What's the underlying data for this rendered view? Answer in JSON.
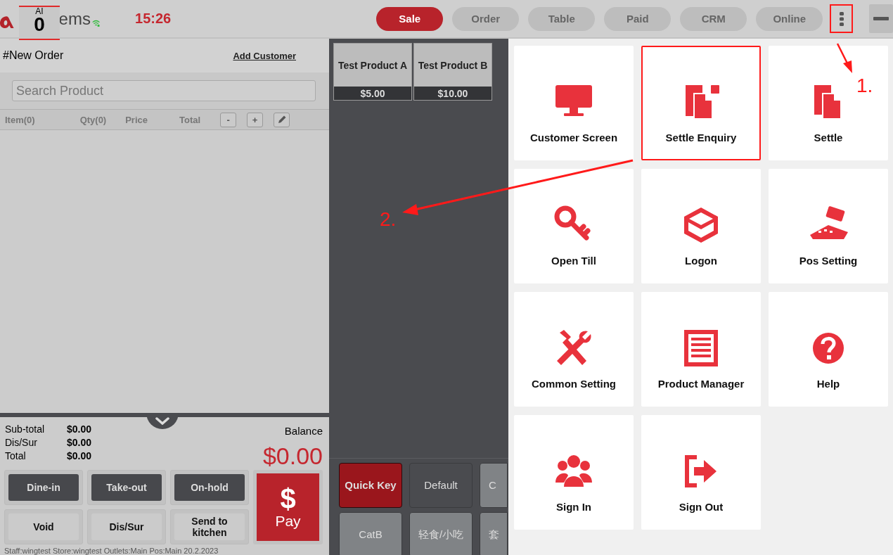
{
  "header": {
    "badge": {
      "label": "AI",
      "count": "0"
    },
    "brand_text": "ems",
    "time": "15:26",
    "tabs": [
      {
        "label": "Sale",
        "selected": true
      },
      {
        "label": "Order",
        "selected": false
      },
      {
        "label": "Table",
        "selected": false
      },
      {
        "label": "Paid",
        "selected": false
      },
      {
        "label": "CRM",
        "selected": false
      },
      {
        "label": "Online",
        "selected": false
      }
    ],
    "more_button": {
      "highlighted": true
    }
  },
  "order": {
    "title": "#New Order",
    "add_customer": "Add Customer",
    "search": {
      "placeholder": "Search Product"
    },
    "columns": [
      "Item(0)",
      "Qty(0)",
      "Price",
      "Total"
    ],
    "qty_buttons": [
      "-",
      "+"
    ],
    "summary": [
      {
        "label": "Sub-total",
        "value": "$0.00"
      },
      {
        "label": "Dis/Sur",
        "value": "$0.00"
      },
      {
        "label": "Total",
        "value": "$0.00"
      }
    ],
    "balance_label": "Balance",
    "balance": "$0.00",
    "order_types": [
      "Dine-in",
      "Take-out",
      "On-hold"
    ],
    "actions": [
      "Void",
      "Dis/Sur",
      "Send to kitchen"
    ],
    "pay": {
      "symbol": "$",
      "label": "Pay"
    },
    "status_text": "Staff:wingtest Store:wingtest  Outlets:Main  Pos:Main 20.2.2023"
  },
  "products": [
    {
      "name": "Test Product A",
      "price": "$5.00"
    },
    {
      "name": "Test Product B",
      "price": "$10.00"
    }
  ],
  "categories": [
    {
      "label": "Quick Key",
      "selected": true,
      "color": "#9a161c"
    },
    {
      "label": "Default",
      "selected": false,
      "color": "#4a4b4f"
    },
    {
      "label": "C",
      "selected": false,
      "color": "#808386"
    },
    {
      "label": "CatB",
      "selected": false,
      "color": "#808386"
    },
    {
      "label": "轻食/小吃",
      "selected": false,
      "color": "#808386"
    },
    {
      "label": "套",
      "selected": false,
      "color": "#808386"
    }
  ],
  "menu": [
    {
      "label": "Customer Screen",
      "highlighted": false
    },
    {
      "label": "Settle Enquiry",
      "highlighted": true
    },
    {
      "label": "Settle",
      "highlighted": false
    },
    {
      "label": "Open Till",
      "highlighted": false
    },
    {
      "label": "Logon",
      "highlighted": false
    },
    {
      "label": "Pos Setting",
      "highlighted": false
    },
    {
      "label": "Common Setting",
      "highlighted": false
    },
    {
      "label": "Product Manager",
      "highlighted": false
    },
    {
      "label": "Help",
      "highlighted": false
    },
    {
      "label": "Sign In",
      "highlighted": false
    },
    {
      "label": "Sign Out",
      "highlighted": false
    }
  ],
  "annotations": [
    {
      "label": "1."
    },
    {
      "label": "2."
    }
  ]
}
